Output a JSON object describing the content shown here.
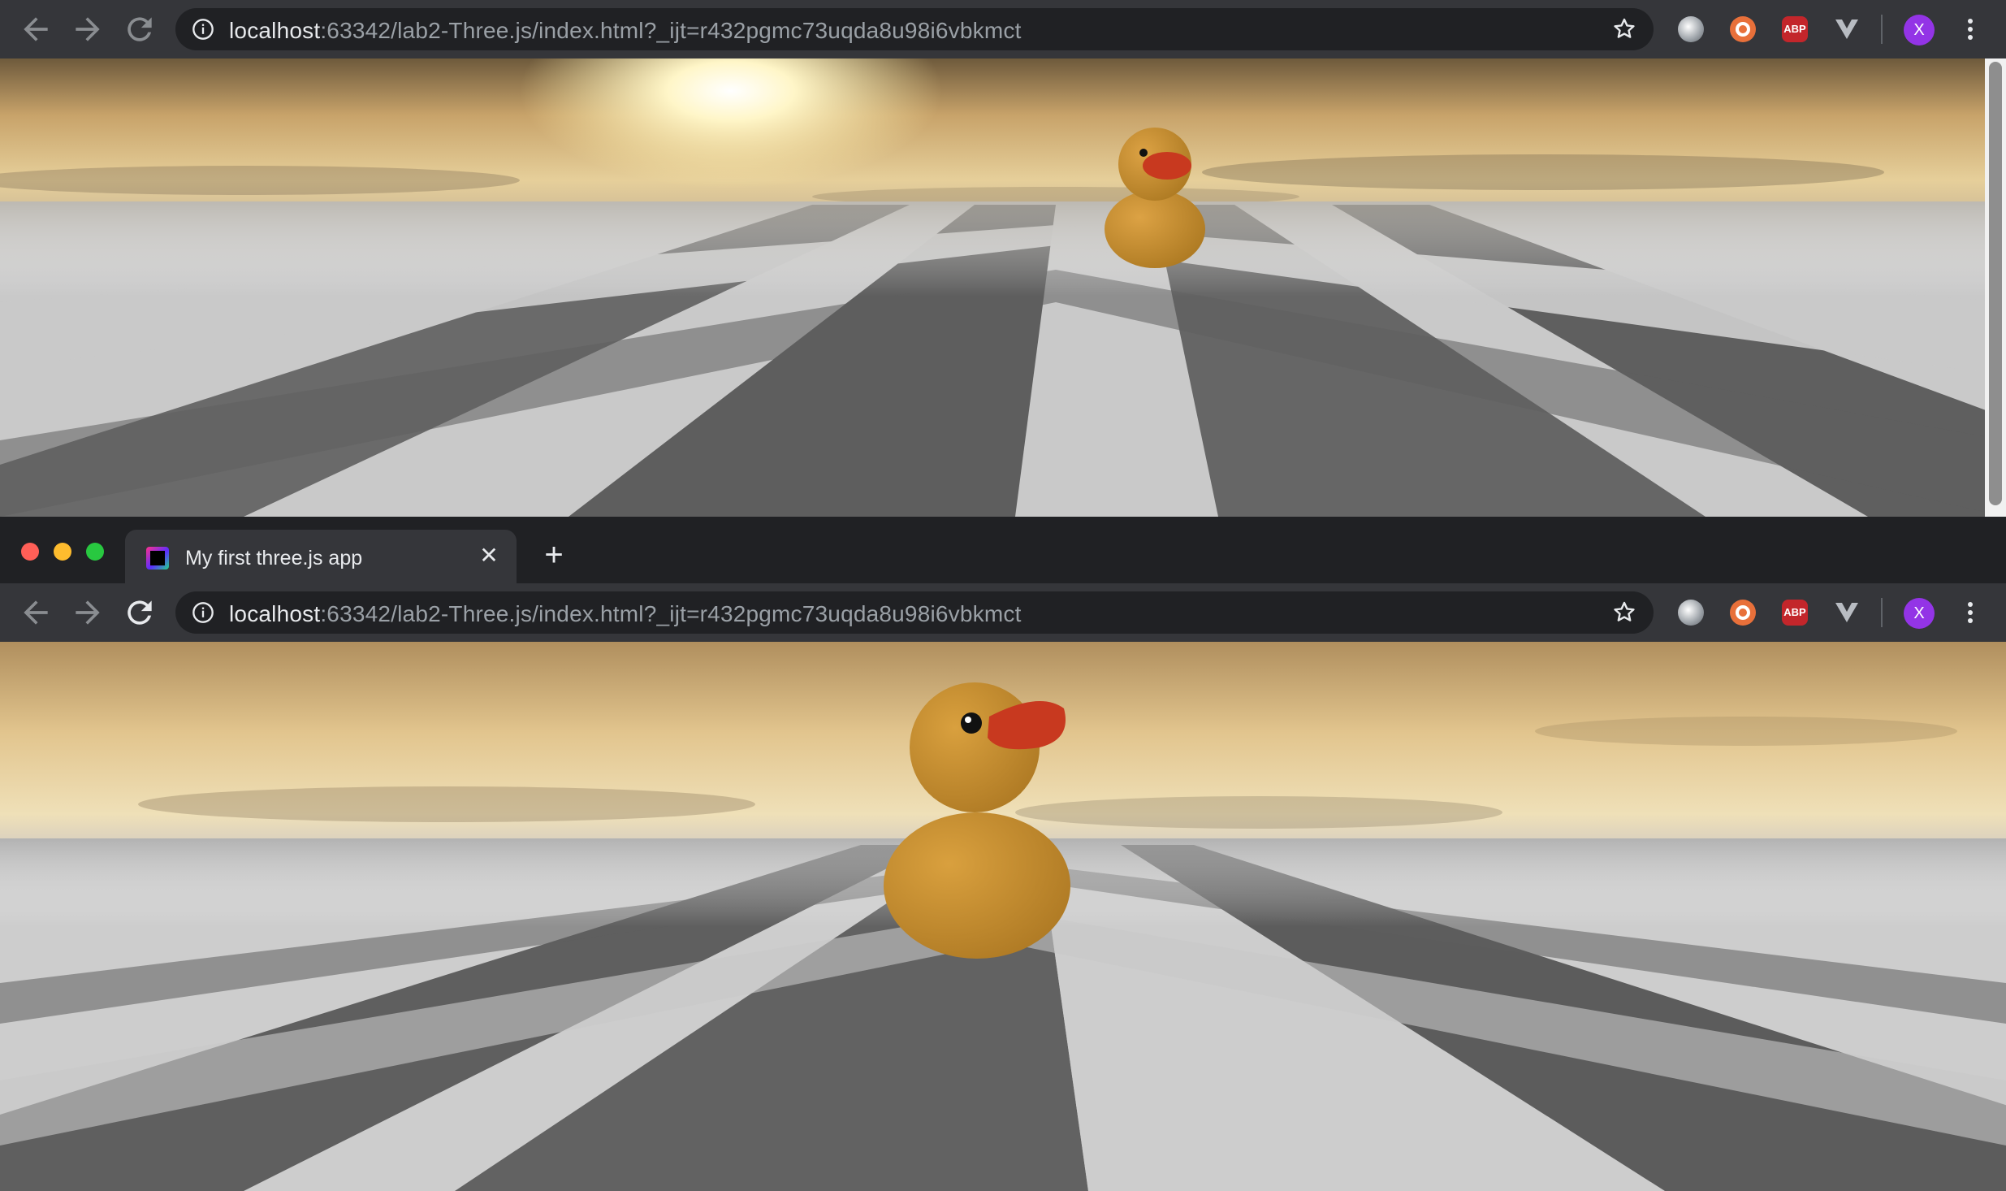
{
  "top_window": {
    "url": {
      "host": "localhost",
      "rest": ":63342/lab2-Three.js/index.html?_ijt=r432pgmc73uqda8u98i6vbkmct"
    }
  },
  "bottom_window": {
    "tab": {
      "title": "My first three.js app",
      "close_glyph": "✕"
    },
    "new_tab_glyph": "+",
    "url": {
      "host": "localhost",
      "rest": ":63342/lab2-Three.js/index.html?_ijt=r432pgmc73uqda8u98i6vbkmct"
    }
  },
  "extensions": {
    "abp_label": "ABP",
    "profile_initial": "X"
  },
  "icons": {
    "back": "back-arrow-icon",
    "forward": "forward-arrow-icon",
    "reload": "reload-icon",
    "info": "info-icon",
    "bookmark": "star-icon",
    "ext1": "chrome-extension-icon",
    "ext2": "lifebuoy-extension-icon",
    "ext3": "adblock-plus-icon",
    "ext4": "vue-devtools-icon",
    "menu": "kebab-menu-icon"
  },
  "colors": {
    "chrome_dark": "#202124",
    "toolbar": "#35363a",
    "duck_body": "#c98f2e",
    "duck_beak": "#c8391f",
    "sky_glow": "#fff2b0",
    "tile_light": "#cfcfcf",
    "tile_dark": "#5a5a5a",
    "traffic_red": "#ff5f57",
    "traffic_yellow": "#febc2e",
    "traffic_green": "#28c840"
  }
}
